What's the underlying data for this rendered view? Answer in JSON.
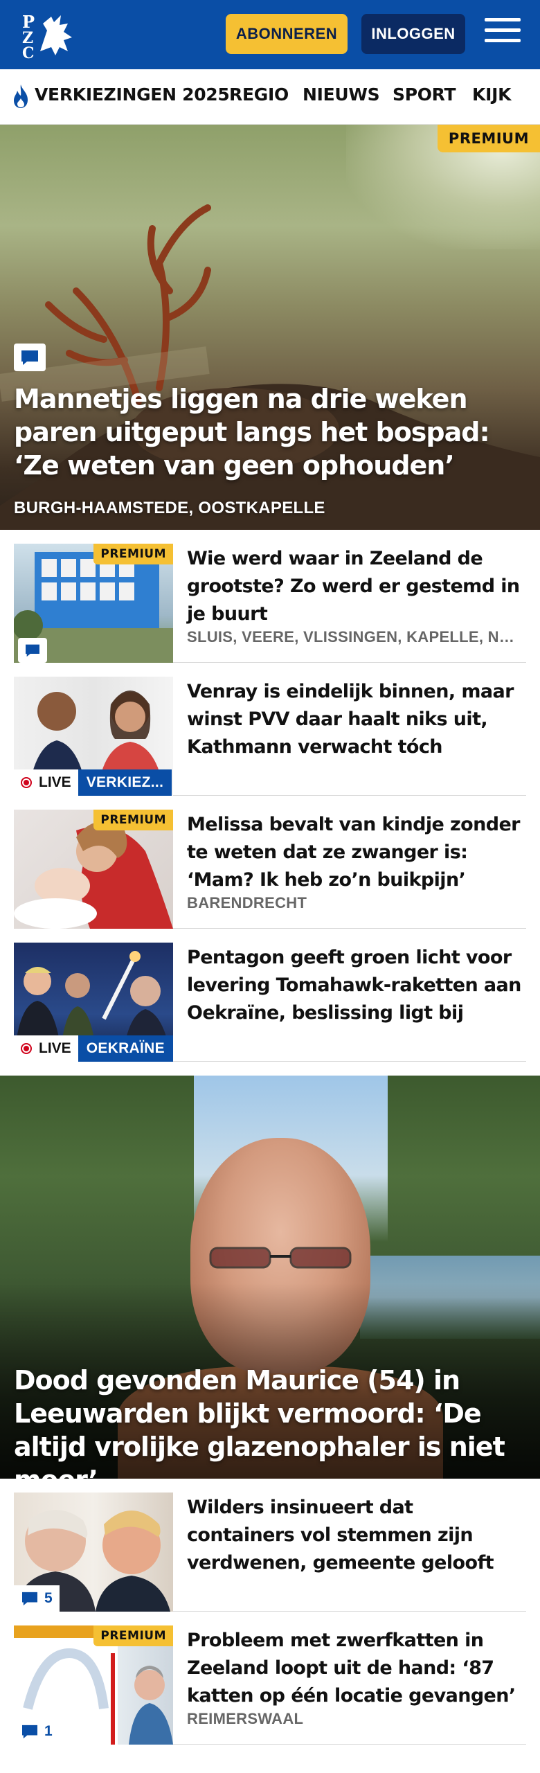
{
  "header": {
    "subscribe_label": "ABONNEREN",
    "login_label": "INLOGGEN",
    "brand_color": "#0a4ea6",
    "accent_color": "#f5c033"
  },
  "nav": {
    "items": [
      {
        "label": "VERKIEZINGEN 2025",
        "icon": "flame-icon"
      },
      {
        "label": "REGIO"
      },
      {
        "label": "NIEUWS"
      },
      {
        "label": "SPORT"
      },
      {
        "label": "KIJK"
      }
    ]
  },
  "hero1": {
    "badge": "PREMIUM",
    "title": "Mannetjes liggen na drie weken paren uitgeput langs het bospad: ‘Ze weten van geen ophouden’",
    "location": "BURGH-HAAMSTEDE, OOSTKAPELLE"
  },
  "articles": [
    {
      "badge": "PREMIUM",
      "title": "Wie werd waar in Zeeland de grootste? Zo werd er gestemd in je buurt",
      "location": "SLUIS, VEERE, VLISSINGEN, KAPELLE, NOORD-BEVELAND"
    },
    {
      "title": "Venray is eindelijk binnen, maar winst PVV daar haalt niks uit, Kathmann verwacht tóch Kamerzetels",
      "live_label": "LIVE",
      "category": "VERKIEZ..."
    },
    {
      "badge": "PREMIUM",
      "title": "Melissa bevalt van kindje zonder te weten dat ze zwanger is: ‘Mam? Ik heb zo’n buikpijn’",
      "location": "BARENDRECHT"
    },
    {
      "title": "Pentagon geeft groen licht voor levering Tomahawk-raketten aan Oekraïne, beslissing ligt bij Trump",
      "live_label": "LIVE",
      "category": "OEKRAÏNE"
    }
  ],
  "hero2": {
    "title": "Dood gevonden Maurice (54) in Leeuwarden blijkt vermoord: ‘De altijd vrolijke glazenophaler is niet meer’"
  },
  "articles2": [
    {
      "title": "Wilders insinueert dat containers vol stemmen zijn verdwenen, gemeente gelooft oren niet: ‘Dit is onzin’",
      "comment_count": "5"
    },
    {
      "badge": "PREMIUM",
      "title": "Probleem met zwerfkatten in Zeeland loopt uit de hand: ‘87 katten op één locatie gevangen’",
      "location": "REIMERSWAAL",
      "comment_count": "1"
    }
  ]
}
